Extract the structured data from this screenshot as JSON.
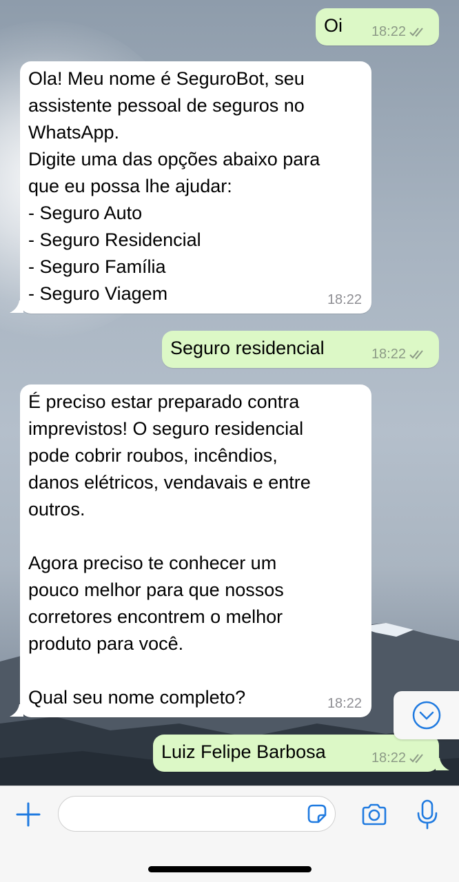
{
  "messages": [
    {
      "direction": "out",
      "text": "Oi",
      "time": "18:22"
    },
    {
      "direction": "in",
      "text": "Ola! Meu nome é SeguroBot, seu\nassistente pessoal de seguros no\nWhatsApp.\nDigite uma das opções abaixo para\nque eu possa lhe ajudar:\n- Seguro Auto\n- Seguro Residencial\n- Seguro Família\n- Seguro Viagem",
      "time": "18:22"
    },
    {
      "direction": "out",
      "text": "Seguro residencial",
      "time": "18:22"
    },
    {
      "direction": "in",
      "text": "É preciso estar preparado contra\nimprevistos! O seguro residencial\npode cobrir roubos, incêndios,\ndanos elétricos, vendavais e entre\noutros.\n\nAgora preciso te conhecer um\npouco melhor para que nossos\ncorretores encontrem o melhor\nproduto para você.\n\nQual seu nome completo?",
      "time": "18:22"
    },
    {
      "direction": "out",
      "text": "Luiz Felipe Barbosa",
      "time": "18:22"
    }
  ],
  "input": {
    "value": "",
    "placeholder": ""
  },
  "icons": {
    "add": "plus-icon",
    "sticker": "sticker-icon",
    "camera": "camera-icon",
    "mic": "microphone-icon",
    "scroll": "chevron-down-circle-icon",
    "read_receipt": "double-check-icon"
  },
  "colors": {
    "accent": "#1f7ae0",
    "bubble_out": "#dcf8c6",
    "bubble_in": "#ffffff",
    "ticks": "#8c9a86"
  }
}
